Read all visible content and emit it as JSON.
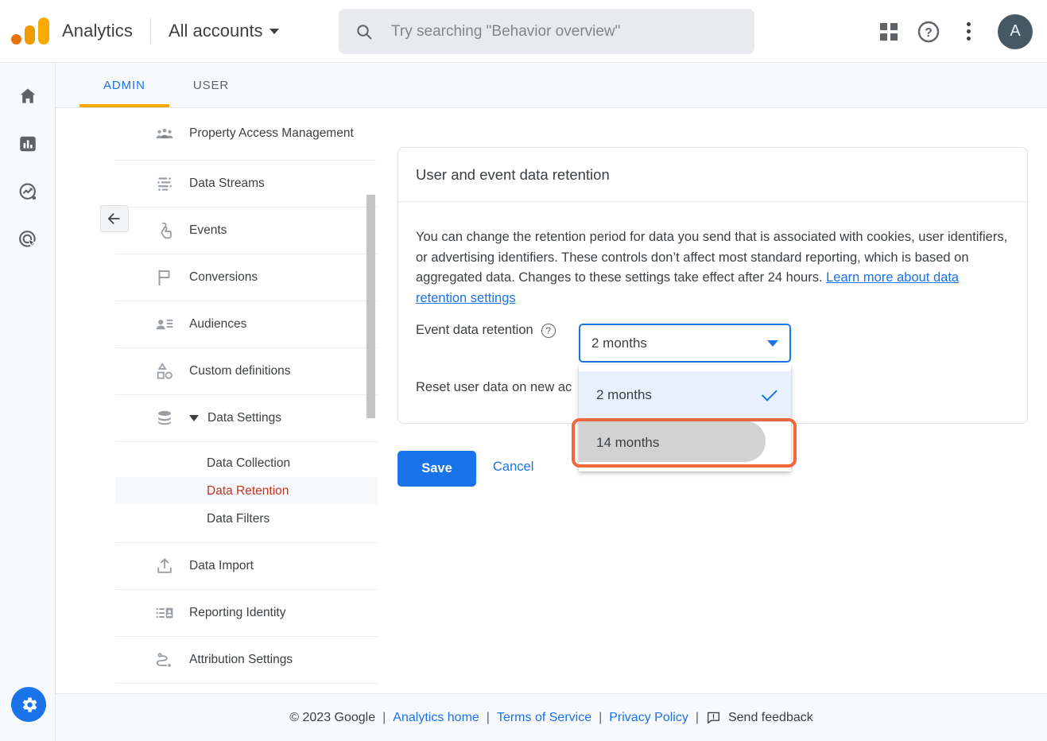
{
  "header": {
    "brand": "Analytics",
    "account_selector": "All accounts",
    "search_placeholder": "Try searching \"Behavior overview\"",
    "avatar_initial": "A",
    "icons": {
      "grid": "grid-apps-icon",
      "help": "help-question-icon",
      "kebab": "more-vertical-icon",
      "search": "search-icon"
    }
  },
  "left_rail": {
    "items": [
      {
        "name": "home",
        "label": "Home"
      },
      {
        "name": "reports",
        "label": "Reports"
      },
      {
        "name": "explore",
        "label": "Explore"
      },
      {
        "name": "advertising",
        "label": "Advertising"
      }
    ],
    "gear_label": "Admin"
  },
  "tabs": [
    {
      "label": "ADMIN",
      "active": true
    },
    {
      "label": "USER",
      "active": false
    }
  ],
  "nav": {
    "back_label": "Back",
    "items": [
      {
        "label": "Property Access Management",
        "icon": "people-group-icon",
        "two_line": true
      },
      {
        "label": "Data Streams",
        "icon": "data-streams-icon"
      },
      {
        "label": "Events",
        "icon": "tap-hand-icon"
      },
      {
        "label": "Conversions",
        "icon": "flag-icon"
      },
      {
        "label": "Audiences",
        "icon": "audiences-person-list-icon"
      },
      {
        "label": "Custom definitions",
        "icon": "shapes-icon"
      }
    ],
    "data_settings": {
      "label": "Data Settings",
      "icon": "database-stack-icon",
      "expanded": true,
      "children": [
        {
          "label": "Data Collection",
          "selected": false
        },
        {
          "label": "Data Retention",
          "selected": true
        },
        {
          "label": "Data Filters",
          "selected": false
        }
      ]
    },
    "items_after": [
      {
        "label": "Data Import",
        "icon": "upload-icon"
      },
      {
        "label": "Reporting Identity",
        "icon": "reporting-identity-icon"
      },
      {
        "label": "Attribution Settings",
        "icon": "attribution-path-icon"
      }
    ]
  },
  "card": {
    "title": "User and event data retention",
    "description_part1": "You can change the retention period for data you send that is associated with cookies, user identifiers, or advertising identifiers. These controls don’t affect most standard reporting, which is based on aggregated data. Changes to these settings take effect after 24 hours. ",
    "description_link": "Learn more about data retention settings",
    "event_retention_label": "Event data retention",
    "reset_user_data_label": "Reset user data on new ac",
    "save_label": "Save",
    "cancel_label": "Cancel"
  },
  "select": {
    "value": "2 months",
    "options": [
      {
        "label": "2 months",
        "selected": true,
        "highlighted": false
      },
      {
        "label": "14 months",
        "selected": false,
        "highlighted": true
      }
    ]
  },
  "footer": {
    "copyright": "© 2023 Google",
    "links": [
      "Analytics home",
      "Terms of Service",
      "Privacy Policy"
    ],
    "feedback": "Send feedback",
    "separator": "|"
  },
  "colors": {
    "brand_orange": "#f9ab00",
    "accent_blue": "#1a73e8",
    "selected_red": "#c5341e",
    "highlight_ring": "#f2683c",
    "menu_selected_bg": "#e8f0fe"
  }
}
